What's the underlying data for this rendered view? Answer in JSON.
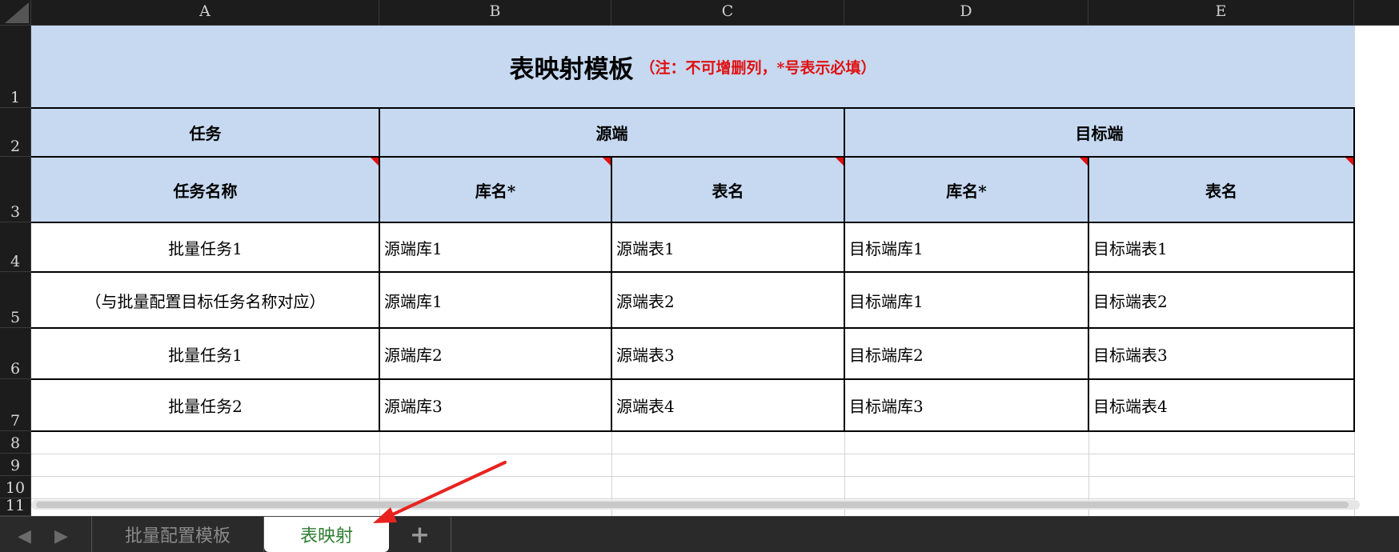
{
  "columns": [
    "A",
    "B",
    "C",
    "D",
    "E"
  ],
  "rows": [
    "1",
    "2",
    "3",
    "4",
    "5",
    "6",
    "7",
    "8",
    "9",
    "10",
    "11"
  ],
  "title": {
    "main": "表映射模板",
    "note": "（注：不可增删列，*号表示必填）"
  },
  "group_headers": {
    "task": "任务",
    "source": "源端",
    "target": "目标端"
  },
  "sub_headers": {
    "task_name": "任务名称",
    "source_db": "库名*",
    "source_table": "表名",
    "target_db": "库名*",
    "target_table": "表名"
  },
  "table_rows": [
    [
      "批量任务1",
      "源端库1",
      "源端表1",
      "目标端库1",
      "目标端表1"
    ],
    [
      "（与批量配置目标任务名称对应）",
      "源端库1",
      "源端表2",
      "目标端库1",
      "目标端表2"
    ],
    [
      "批量任务1",
      "源端库2",
      "源端表3",
      "目标端库2",
      "目标端表3"
    ],
    [
      "批量任务2",
      "源端库3",
      "源端表4",
      "目标端库3",
      "目标端表4"
    ]
  ],
  "sheet_tabs": [
    "批量配置模板",
    "表映射"
  ],
  "active_tab": "表映射",
  "add_sheet_icon": "plus-icon",
  "colors": {
    "header_fill": "#c6d9f1",
    "note_red": "#e01010",
    "active_tab_text": "#2e7d32",
    "annotation_arrow": "#e8231f"
  }
}
